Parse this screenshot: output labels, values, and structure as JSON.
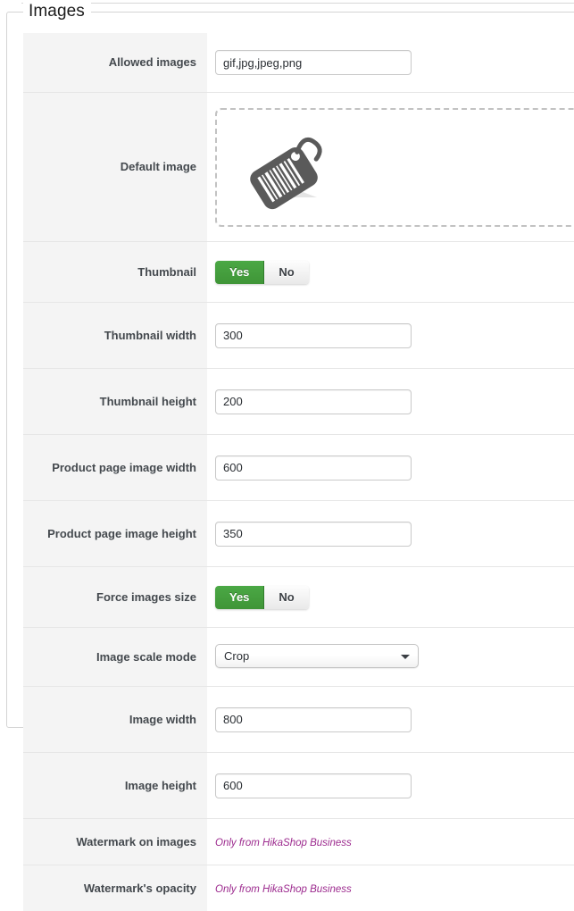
{
  "fieldset": {
    "legend": "Images"
  },
  "rows": [
    {
      "label": "Allowed images",
      "type": "text",
      "value": "gif,jpg,jpeg,png",
      "placeholder": ""
    },
    {
      "label": "Default image",
      "type": "dropzone",
      "icon": "price-tag-icon"
    },
    {
      "label": "Thumbnail",
      "type": "toggle",
      "yes_label": "Yes",
      "no_label": "No",
      "selected": "Yes"
    },
    {
      "label": "Thumbnail width",
      "type": "text",
      "value": "300",
      "placeholder": ""
    },
    {
      "label": "Thumbnail height",
      "type": "text",
      "value": "200",
      "placeholder": ""
    },
    {
      "label": "Product page image width",
      "type": "text",
      "value": "600",
      "placeholder": ""
    },
    {
      "label": "Product page image height",
      "type": "text",
      "value": "350",
      "placeholder": ""
    },
    {
      "label": "Force images size",
      "type": "toggle",
      "yes_label": "Yes",
      "no_label": "No",
      "selected": "Yes"
    },
    {
      "label": "Image scale mode",
      "type": "select",
      "value": "Crop",
      "options": [
        "Crop"
      ]
    },
    {
      "label": "Image width",
      "type": "text",
      "value": "800",
      "placeholder": ""
    },
    {
      "label": "Image height",
      "type": "text",
      "value": "600",
      "placeholder": ""
    },
    {
      "label": "Watermark on images",
      "type": "note",
      "value": "Only from HikaShop Business"
    },
    {
      "label": "Watermark's opacity",
      "type": "note",
      "value": "Only from HikaShop Business"
    }
  ],
  "colors": {
    "toggle_on": "#3f9537",
    "label_text": "#44494e",
    "note_text": "#9c2a8e",
    "label_background": "#f4f4f4",
    "border": "#d4d4d4"
  }
}
